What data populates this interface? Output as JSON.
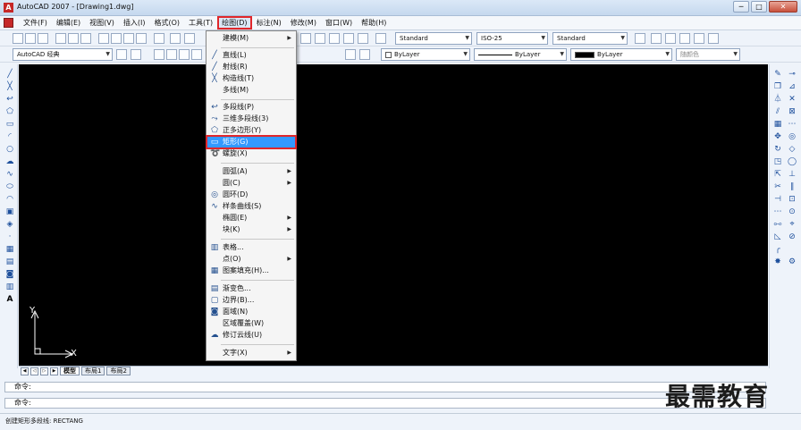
{
  "window": {
    "title": "AutoCAD 2007 - [Drawing1.dwg]",
    "controls": [
      "─",
      "□",
      "✕"
    ]
  },
  "menubar": {
    "items": [
      {
        "label": "文件(F)"
      },
      {
        "label": "编辑(E)"
      },
      {
        "label": "视图(V)"
      },
      {
        "label": "插入(I)"
      },
      {
        "label": "格式(O)"
      },
      {
        "label": "工具(T)"
      },
      {
        "label": "绘图(D)",
        "active": true
      },
      {
        "label": "标注(N)"
      },
      {
        "label": "修改(M)"
      },
      {
        "label": "窗口(W)"
      },
      {
        "label": "帮助(H)"
      }
    ]
  },
  "toolbar": {
    "text_style": "Standard",
    "dim_style": "ISO-25",
    "table_style": "Standard",
    "workspace": "AutoCAD 经典",
    "layer_color": "ByLayer",
    "linetype": "ByLayer",
    "lineweight": "ByLayer",
    "plot_style": "随颜色"
  },
  "draw_menu": {
    "items": [
      {
        "label": "建模(M)",
        "submenu": true,
        "icon": ""
      },
      {
        "label": "直线(L)",
        "icon": "line-icon"
      },
      {
        "label": "射线(R)",
        "icon": "ray-icon"
      },
      {
        "label": "构造线(T)",
        "icon": "xline-icon"
      },
      {
        "label": "多线(M)",
        "icon": ""
      },
      {
        "label": "多段线(P)",
        "icon": "polyline-icon"
      },
      {
        "label": "三维多段线(3)",
        "icon": "3dpoly-icon"
      },
      {
        "label": "正多边形(Y)",
        "icon": "polygon-icon"
      },
      {
        "label": "矩形(G)",
        "icon": "rectangle-icon",
        "highlighted": true
      },
      {
        "label": "螺旋(X)",
        "icon": "helix-icon"
      },
      {
        "label": "圆弧(A)",
        "submenu": true,
        "icon": ""
      },
      {
        "label": "圆(C)",
        "submenu": true,
        "icon": ""
      },
      {
        "label": "圆环(D)",
        "icon": "donut-icon"
      },
      {
        "label": "样条曲线(S)",
        "icon": "spline-icon"
      },
      {
        "label": "椭圆(E)",
        "submenu": true,
        "icon": ""
      },
      {
        "label": "块(K)",
        "submenu": true,
        "icon": ""
      },
      {
        "label": "表格...",
        "icon": "table-icon"
      },
      {
        "label": "点(O)",
        "submenu": true,
        "icon": ""
      },
      {
        "label": "图案填充(H)...",
        "icon": "hatch-icon"
      },
      {
        "label": "渐变色...",
        "icon": "gradient-icon"
      },
      {
        "label": "边界(B)...",
        "icon": "boundary-icon"
      },
      {
        "label": "面域(N)",
        "icon": "region-icon"
      },
      {
        "label": "区域覆盖(W)",
        "icon": ""
      },
      {
        "label": "修订云线(U)",
        "icon": "revcloud-icon"
      },
      {
        "label": "文字(X)",
        "submenu": true,
        "icon": ""
      }
    ]
  },
  "ucs": {
    "x_label": "X",
    "y_label": "Y"
  },
  "layout_tabs": [
    "模型",
    "布局1",
    "布局2"
  ],
  "command_line": {
    "line1": "命令:",
    "line2": "命令:"
  },
  "status": {
    "text": "创建矩形多段线:  RECTANG"
  },
  "watermark": "最需教育",
  "colors": {
    "canvas_bg": "#000000",
    "highlight": "#3399ff",
    "annotation_red": "#e0262b"
  }
}
